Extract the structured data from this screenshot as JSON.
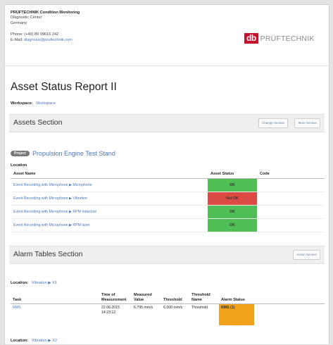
{
  "header": {
    "company": "PRÜFTECHNIK Condition Monitoring",
    "dept": "Diagnostic Center",
    "country": "Germany",
    "phone": "Phone: (+49) 89 99616 242",
    "email_label": "E-Mail:",
    "email": "diagnosis@pruftechnik.com",
    "logo_box": "db",
    "logo_brand": "PRÜFTECHNIK"
  },
  "report": {
    "title": "Asset Status Report II",
    "workspace_label": "Workspace:",
    "workspace_value": "Workspace"
  },
  "assets_section": {
    "title": "Assets Section",
    "btn_change": "Change Section",
    "btn_more": "More Section",
    "badge": "Project",
    "asset_name": "Propulsion Engine Test Stand",
    "location_label": "Location",
    "columns": [
      "Asset Name",
      "Asset Status",
      "Code"
    ],
    "rows": [
      {
        "name": "Event Recording with Microphone ▶ Microphone",
        "status": "OK"
      },
      {
        "name": "Event Recording with Microphone ▶ Vibration",
        "status": "Not OK"
      },
      {
        "name": "Event Recording with Microphone ▶ RPM Inductive",
        "status": "OK"
      },
      {
        "name": "Event Recording with Microphone ▶ RPM laser",
        "status": "OK"
      }
    ]
  },
  "alarms_section": {
    "title": "Alarm Tables Section",
    "btn_action": "Action Section",
    "location_label": "Location:",
    "location_value": "Vibration ▶ X1",
    "columns": [
      "Task",
      "Time of Measurement",
      "Measured Value",
      "Threshold",
      "Threshold Name",
      "Alarm Status"
    ],
    "rows": [
      {
        "task": "RMS",
        "time": "22.06.2015 14:23:12",
        "measured": "6,795 mm/s",
        "threshold": "6,000 mm/s",
        "threshold_name": "Threshold",
        "alarm": "RMS (1)"
      }
    ],
    "location2_label": "Location:",
    "location2_value": "Vibration ▶ X2"
  },
  "colors": {
    "ok": "#4fbe55",
    "not_ok": "#dc4a44",
    "alarm": "#f0a21a",
    "link": "#4a76b8",
    "brand_red": "#c8102e"
  }
}
